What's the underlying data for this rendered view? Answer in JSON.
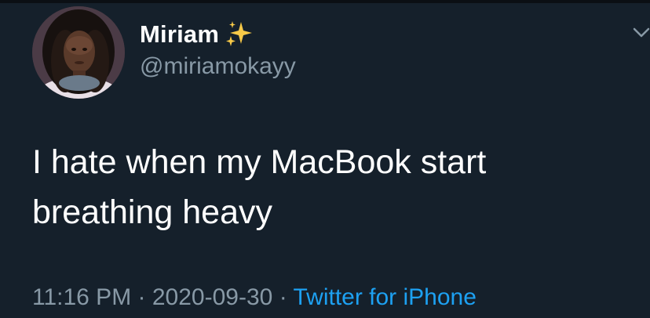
{
  "tweet": {
    "author": {
      "display_name": "Miriam",
      "name_emoji_icon": "sparkles-icon",
      "handle": "@miriamokayy",
      "avatar_icon": "profile-photo"
    },
    "text": "I hate when my MacBook start\nbreathing heavy",
    "time": "11:16 PM",
    "separator": "·",
    "date": "2020-09-30",
    "source": "Twitter for iPhone",
    "menu_icon": "chevron-down-icon"
  },
  "colors": {
    "background": "#15202b",
    "text": "#ffffff",
    "secondary_text": "#8899a6",
    "link": "#1da1f2",
    "sparkle": "#f7c948"
  }
}
